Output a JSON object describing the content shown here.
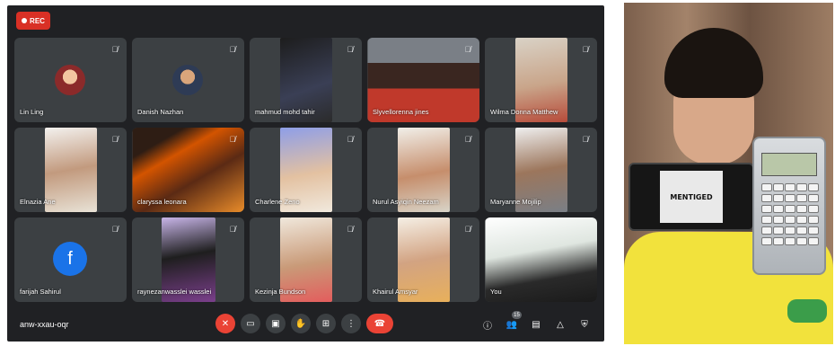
{
  "meeting": {
    "rec_label": "REC",
    "meeting_code": "anw-xxau-oqr",
    "participant_count": "15",
    "participants": [
      {
        "name": "Lin Ling",
        "tile": "avatar"
      },
      {
        "name": "Danish Nazhan",
        "tile": "avatar"
      },
      {
        "name": "mahmud mohd tahir",
        "tile": "video"
      },
      {
        "name": "Slyvellorenna jines",
        "tile": "video"
      },
      {
        "name": "Wilma Donna Matthew",
        "tile": "video"
      },
      {
        "name": "Elnazia Ane",
        "tile": "video"
      },
      {
        "name": "claryssa leonara",
        "tile": "video"
      },
      {
        "name": "Charlene Zeno",
        "tile": "video"
      },
      {
        "name": "Nurul Asyiqin Neezam",
        "tile": "video"
      },
      {
        "name": "Maryanne Mojilip",
        "tile": "video"
      },
      {
        "name": "farijah Sahirul",
        "tile": "avatar",
        "avatar_letter": "f"
      },
      {
        "name": "raynezanwasslei wasslei",
        "tile": "video"
      },
      {
        "name": "Kezinja Bundson",
        "tile": "video"
      },
      {
        "name": "Khairul Amsyar",
        "tile": "video"
      },
      {
        "name": "You",
        "tile": "video"
      }
    ],
    "controls": [
      "mic-off-icon",
      "camera-icon",
      "captions-icon",
      "raise-hand-icon",
      "present-icon",
      "more-options-icon",
      "end-call-icon"
    ],
    "right_icons": [
      "info-icon",
      "people-icon",
      "chat-icon",
      "activities-icon",
      "host-controls-icon"
    ],
    "colors": {
      "background": "#202124",
      "tile": "#3c4043",
      "danger": "#ea4335",
      "avatar_blue": "#1a73e8"
    }
  },
  "photo": {
    "phone_screen_text": "MENTIGED"
  }
}
